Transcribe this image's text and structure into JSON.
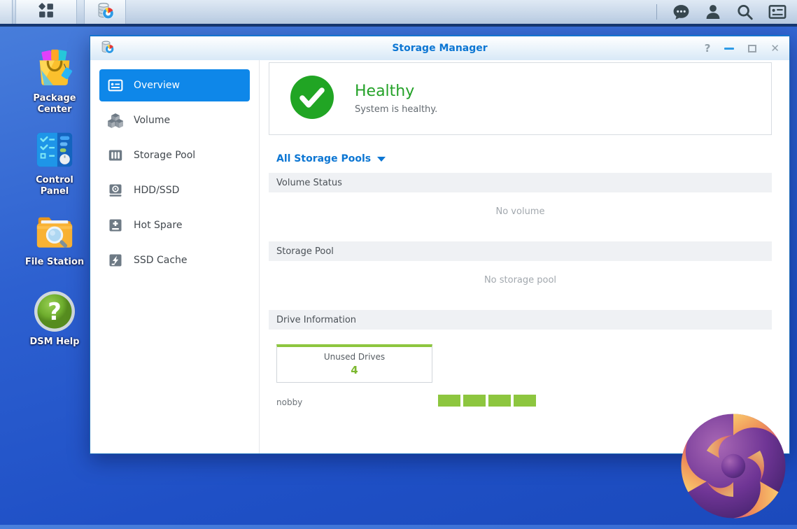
{
  "taskbar": {
    "main_menu_icon": "apps-grid-icon",
    "open_app_icon": "storage-manager-app-icon",
    "right_icons": [
      "chat-icon",
      "user-icon",
      "search-icon",
      "widgets-icon"
    ]
  },
  "desktop": {
    "icons": [
      {
        "label": "Package Center"
      },
      {
        "label": "Control Panel"
      },
      {
        "label": "File Station"
      },
      {
        "label": "DSM Help"
      }
    ]
  },
  "window": {
    "title": "Storage Manager",
    "controls": {
      "help": "?",
      "close": "✕"
    },
    "sidebar": [
      {
        "label": "Overview",
        "icon": "overview-card-icon",
        "active": true
      },
      {
        "label": "Volume",
        "icon": "cubes-icon",
        "active": false
      },
      {
        "label": "Storage Pool",
        "icon": "rack-icon",
        "active": false
      },
      {
        "label": "HDD/SSD",
        "icon": "disk-icon",
        "active": false
      },
      {
        "label": "Hot Spare",
        "icon": "plus-drive-icon",
        "active": false
      },
      {
        "label": "SSD Cache",
        "icon": "bolt-drive-icon",
        "active": false
      }
    ],
    "content": {
      "health": {
        "title": "Healthy",
        "subtitle": "System is healthy."
      },
      "pool_filter": {
        "label": "All Storage Pools"
      },
      "sections": [
        {
          "header": "Volume Status",
          "empty": "No volume"
        },
        {
          "header": "Storage Pool",
          "empty": "No storage pool"
        },
        {
          "header": "Drive Information",
          "empty": ""
        }
      ],
      "unused_drives": {
        "label": "Unused Drives",
        "count": "4"
      },
      "host": {
        "name": "nobby",
        "drive_slot_count": 4
      }
    }
  },
  "icons": {
    "question_glyph": "?"
  },
  "colors": {
    "accent_blue": "#0e87e9",
    "title_blue": "#0c76d3",
    "healthy_green": "#21a524",
    "drive_green": "#8dc63f",
    "taskbar_border_navy": "#16376f",
    "desktop_blue_top": "#4a80dc",
    "desktop_blue_bottom": "#1b4abc"
  }
}
